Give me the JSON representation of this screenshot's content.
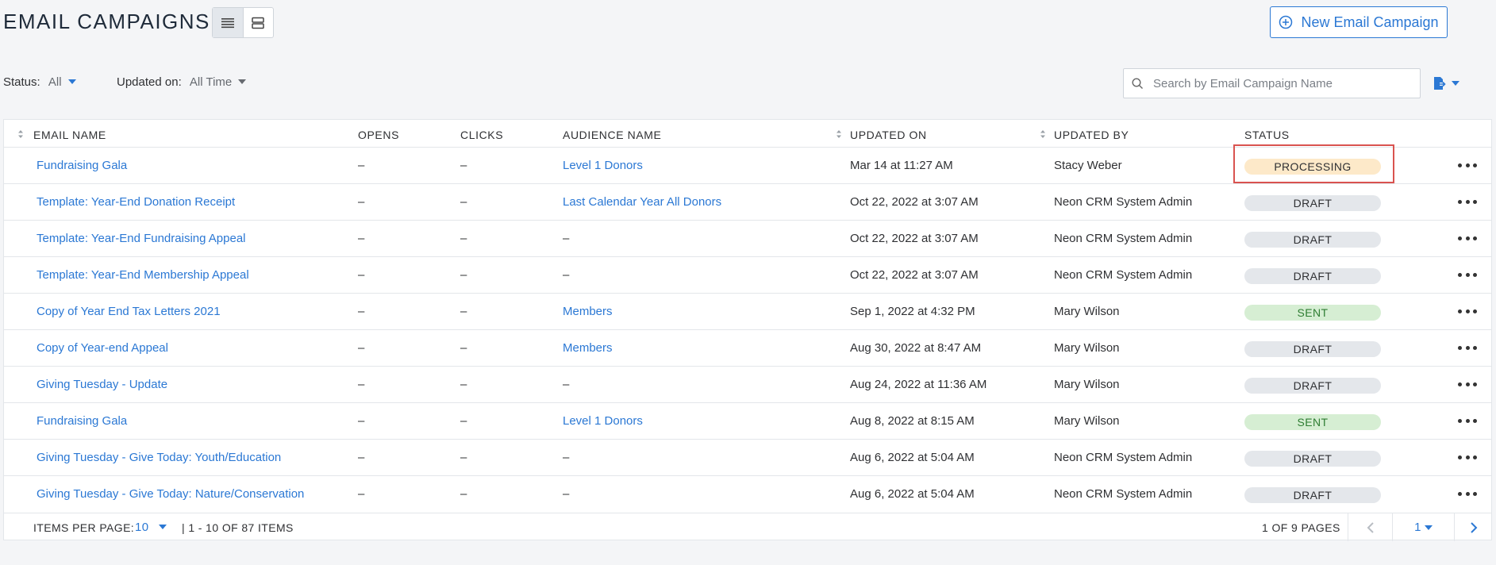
{
  "header": {
    "title": "EMAIL CAMPAIGNS",
    "new_button_label": "New Email Campaign"
  },
  "filters": {
    "status_label": "Status:",
    "status_value": "All",
    "updated_label": "Updated on:",
    "updated_value": "All Time"
  },
  "search": {
    "placeholder": "Search by Email Campaign Name"
  },
  "table": {
    "columns": {
      "email_name": "EMAIL NAME",
      "opens": "OPENS",
      "clicks": "CLICKS",
      "audience": "AUDIENCE NAME",
      "updated_on": "UPDATED ON",
      "updated_by": "UPDATED BY",
      "status": "STATUS"
    },
    "rows": [
      {
        "name": "Fundraising Gala",
        "opens": "–",
        "clicks": "–",
        "audience": "Level 1 Donors",
        "updated_on": "Mar 14 at 11:27 AM",
        "updated_by": "Stacy Weber",
        "status": "PROCESSING"
      },
      {
        "name": "Template: Year-End Donation Receipt",
        "opens": "–",
        "clicks": "–",
        "audience": "Last Calendar Year All Donors",
        "updated_on": "Oct 22, 2022 at 3:07 AM",
        "updated_by": "Neon CRM System Admin",
        "status": "DRAFT"
      },
      {
        "name": "Template: Year-End Fundraising Appeal",
        "opens": "–",
        "clicks": "–",
        "audience": "–",
        "updated_on": "Oct 22, 2022 at 3:07 AM",
        "updated_by": "Neon CRM System Admin",
        "status": "DRAFT"
      },
      {
        "name": "Template: Year-End Membership Appeal",
        "opens": "–",
        "clicks": "–",
        "audience": "–",
        "updated_on": "Oct 22, 2022 at 3:07 AM",
        "updated_by": "Neon CRM System Admin",
        "status": "DRAFT"
      },
      {
        "name": "Copy of Year End Tax Letters 2021",
        "opens": "–",
        "clicks": "–",
        "audience": "Members",
        "updated_on": "Sep 1, 2022 at 4:32 PM",
        "updated_by": "Mary Wilson",
        "status": "SENT"
      },
      {
        "name": "Copy of Year-end Appeal",
        "opens": "–",
        "clicks": "–",
        "audience": "Members",
        "updated_on": "Aug 30, 2022 at 8:47 AM",
        "updated_by": "Mary Wilson",
        "status": "DRAFT"
      },
      {
        "name": "Giving Tuesday - Update",
        "opens": "–",
        "clicks": "–",
        "audience": "–",
        "updated_on": "Aug 24, 2022 at 11:36 AM",
        "updated_by": "Mary Wilson",
        "status": "DRAFT"
      },
      {
        "name": "Fundraising Gala",
        "opens": "–",
        "clicks": "–",
        "audience": "Level 1 Donors",
        "updated_on": "Aug 8, 2022 at 8:15 AM",
        "updated_by": "Mary Wilson",
        "status": "SENT"
      },
      {
        "name": "Giving Tuesday - Give Today: Youth/Education",
        "opens": "–",
        "clicks": "–",
        "audience": "–",
        "updated_on": "Aug 6, 2022 at 5:04 AM",
        "updated_by": "Neon CRM System Admin",
        "status": "DRAFT"
      },
      {
        "name": "Giving Tuesday - Give Today: Nature/Conservation",
        "opens": "–",
        "clicks": "–",
        "audience": "–",
        "updated_on": "Aug 6, 2022 at 5:04 AM",
        "updated_by": "Neon CRM System Admin",
        "status": "DRAFT"
      }
    ]
  },
  "footer": {
    "items_per_page_label": "ITEMS PER PAGE:",
    "items_per_page_value": "10",
    "range_text": "| 1 - 10 OF 87 ITEMS",
    "pages_text": "1 OF 9 PAGES",
    "current_page": "1"
  },
  "icons": {
    "list_view": "list-view-icon",
    "card_view": "card-view-icon",
    "add": "plus-circle-icon",
    "search": "search-icon",
    "export": "export-icon",
    "more": "more-dots-icon",
    "prev": "chevron-left-icon",
    "next": "chevron-right-icon"
  },
  "colors": {
    "accent": "#2b78d4",
    "draft_badge": "#e4e7eb",
    "sent_badge": "#d6eed3",
    "processing_badge": "#fde9c9",
    "highlight": "#d9534f"
  }
}
